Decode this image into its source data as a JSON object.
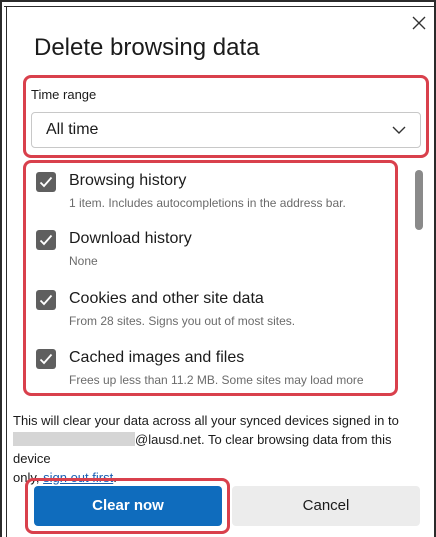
{
  "dialog": {
    "title": "Delete browsing data",
    "close_icon": "close-icon"
  },
  "time_range": {
    "label": "Time range",
    "selected": "All time"
  },
  "items": [
    {
      "title": "Browsing history",
      "subtitle": "1 item. Includes autocompletions in the address bar.",
      "checked": true
    },
    {
      "title": "Download history",
      "subtitle": "None",
      "checked": true
    },
    {
      "title": "Cookies and other site data",
      "subtitle": "From 28 sites. Signs you out of most sites.",
      "checked": true
    },
    {
      "title": "Cached images and files",
      "subtitle": "Frees up less than 11.2 MB. Some sites may load more",
      "checked": true
    }
  ],
  "info": {
    "line1": "This will clear your data across all your synced devices signed in to",
    "email_suffix": "@lausd.net. To clear browsing data from this device",
    "line3_prefix": "only, ",
    "link": "sign out first",
    "line3_suffix": "."
  },
  "buttons": {
    "clear": "Clear now",
    "cancel": "Cancel"
  },
  "colors": {
    "primary": "#0f6cbd",
    "highlight": "#d9404c",
    "checkbox": "#5f5f5f"
  }
}
